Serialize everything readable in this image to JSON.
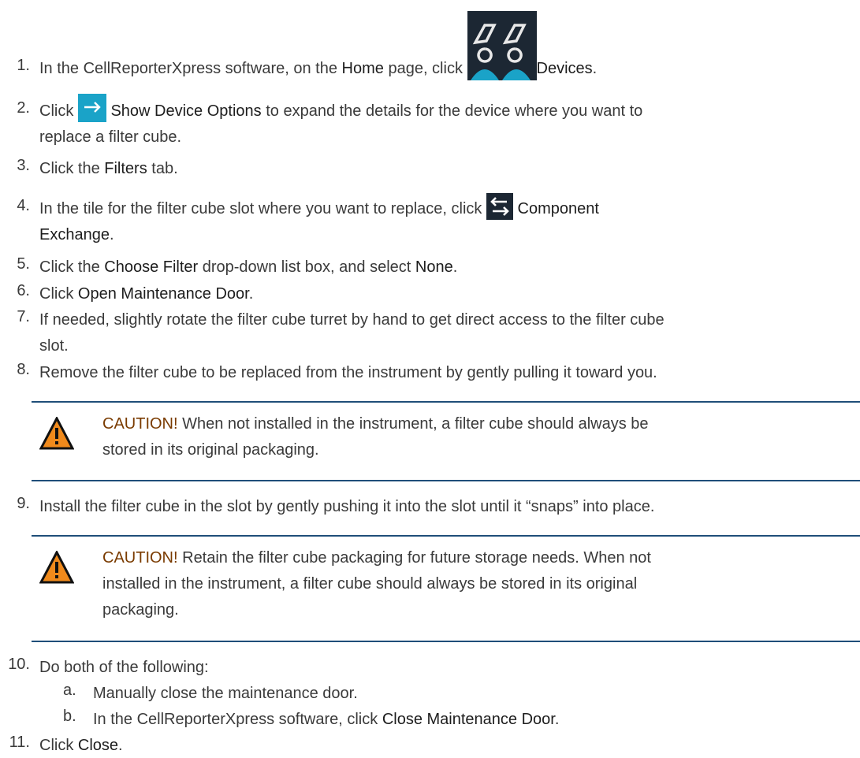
{
  "steps": [
    {
      "n": "1.",
      "a": "In the CellReporterXpress software, on the ",
      "b": "Home",
      "c": " page, click ",
      "d": "Devices",
      "e": "."
    },
    {
      "n": "2.",
      "a": "Click ",
      "b": "Show Device Options",
      "c": " to expand the details for the device where you want to",
      "d": "replace a filter cube."
    },
    {
      "n": "3.",
      "a": "Click the ",
      "b": "Filters",
      "c": " tab."
    },
    {
      "n": "4.",
      "a": "In the tile for the filter cube slot where you want to replace, click ",
      "b": "Component",
      "c": "Exchange",
      "d": "."
    },
    {
      "n": "5.",
      "a": "Click the ",
      "b": "Choose Filter",
      "c": " drop-down list box, and select ",
      "d": "None",
      "e": "."
    },
    {
      "n": "6.",
      "a": "Click ",
      "b": "Open Maintenance Door",
      "c": "."
    },
    {
      "n": "7.",
      "a": "If needed, slightly rotate the filter cube turret by hand to get direct access to the filter cube",
      "b": "slot."
    },
    {
      "n": "8.",
      "a": "Remove the filter cube to be replaced from the instrument by gently pulling it toward you."
    },
    {
      "n": "9.",
      "a": "Install the filter cube in the slot by gently pushing it into the slot until it “snaps” into place."
    },
    {
      "n": "10.",
      "a": "Do both of the following:"
    },
    {
      "n": "11.",
      "a": "Click ",
      "b": "Close",
      "c": "."
    }
  ],
  "substeps": [
    {
      "n": "a.",
      "a": "Manually close the maintenance door."
    },
    {
      "n": "b.",
      "a": "In the CellReporterXpress software, click ",
      "b": "Close Maintenance Door",
      "c": "."
    }
  ],
  "cautions": [
    {
      "label": "CAUTION!",
      "l1": " When not installed in the instrument, a filter cube should always be",
      "l2": "stored in its original packaging."
    },
    {
      "label": "CAUTION!",
      "l1": " Retain the filter cube packaging for future storage needs. When not",
      "l2": "installed in the instrument, a filter cube should always be stored in its original",
      "l3": "packaging."
    }
  ],
  "colors": {
    "caution_label": "#7a3b00",
    "rule": "#1f4e79",
    "teal": "#1aa3c8"
  },
  "icons": [
    "devices-icon",
    "arrow-right-icon",
    "component-exchange-icon",
    "caution-icon"
  ]
}
